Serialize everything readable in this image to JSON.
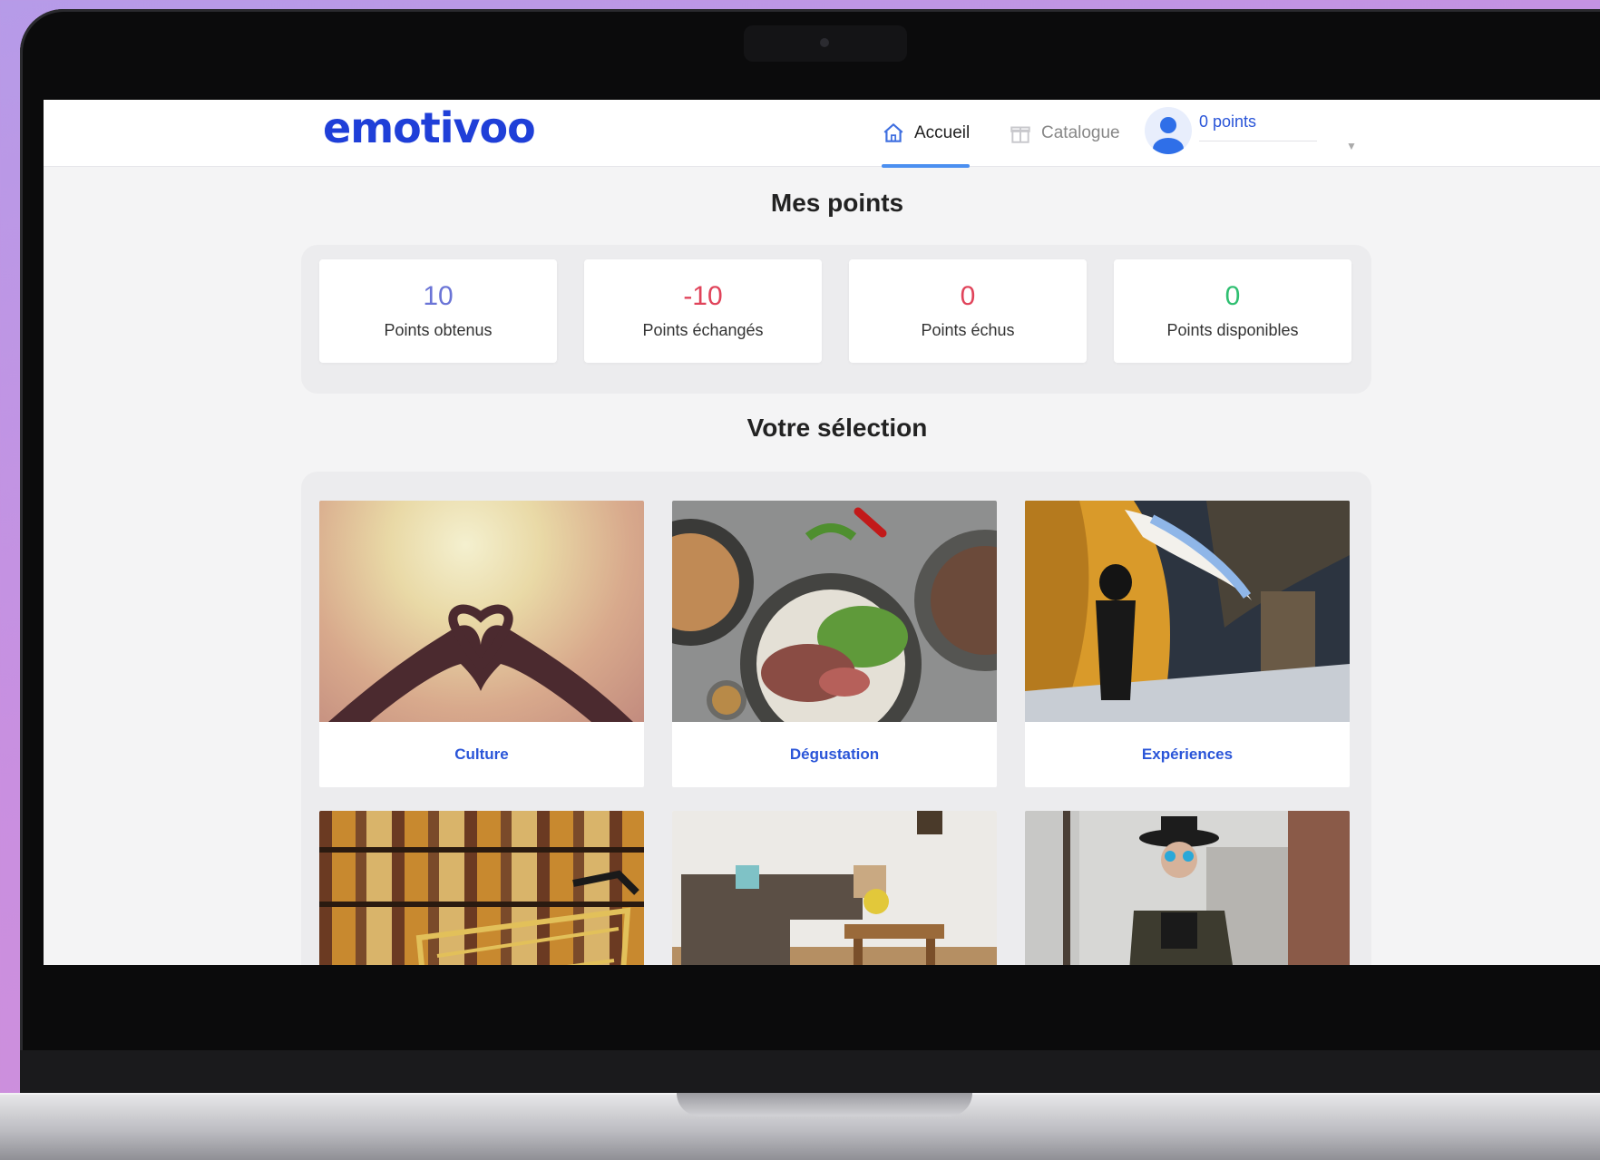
{
  "app": {
    "logo": "emotivoo"
  },
  "nav": {
    "items": [
      {
        "label": "Accueil",
        "icon": "home-icon",
        "active": true
      },
      {
        "label": "Catalogue",
        "icon": "gift-icon",
        "active": false
      }
    ],
    "user": {
      "points_label": "0 points",
      "icon": "user-avatar-icon"
    }
  },
  "points_section": {
    "title": "Mes points",
    "stats": [
      {
        "value": "10",
        "label": "Points obtenus",
        "color": "#6a74d6"
      },
      {
        "value": "-10",
        "label": "Points échangés",
        "color": "#e0435a"
      },
      {
        "value": "0",
        "label": "Points échus",
        "color": "#e0435a"
      },
      {
        "value": "0",
        "label": "Points disponibles",
        "color": "#2fbf71"
      }
    ]
  },
  "selection_section": {
    "title": "Votre sélection",
    "categories": [
      {
        "label": "Culture",
        "image": "heart-hands-sunset-image"
      },
      {
        "label": "Dégustation",
        "image": "food-plates-image"
      },
      {
        "label": "Expériences",
        "image": "hot-air-balloon-image"
      },
      {
        "label": "",
        "image": "grocery-cart-image"
      },
      {
        "label": "",
        "image": "living-room-image"
      },
      {
        "label": "",
        "image": "fashion-woman-hat-image"
      }
    ]
  },
  "colors": {
    "brand": "#1f3fd8",
    "accent": "#4b8ff0",
    "link": "#2a55d8"
  }
}
